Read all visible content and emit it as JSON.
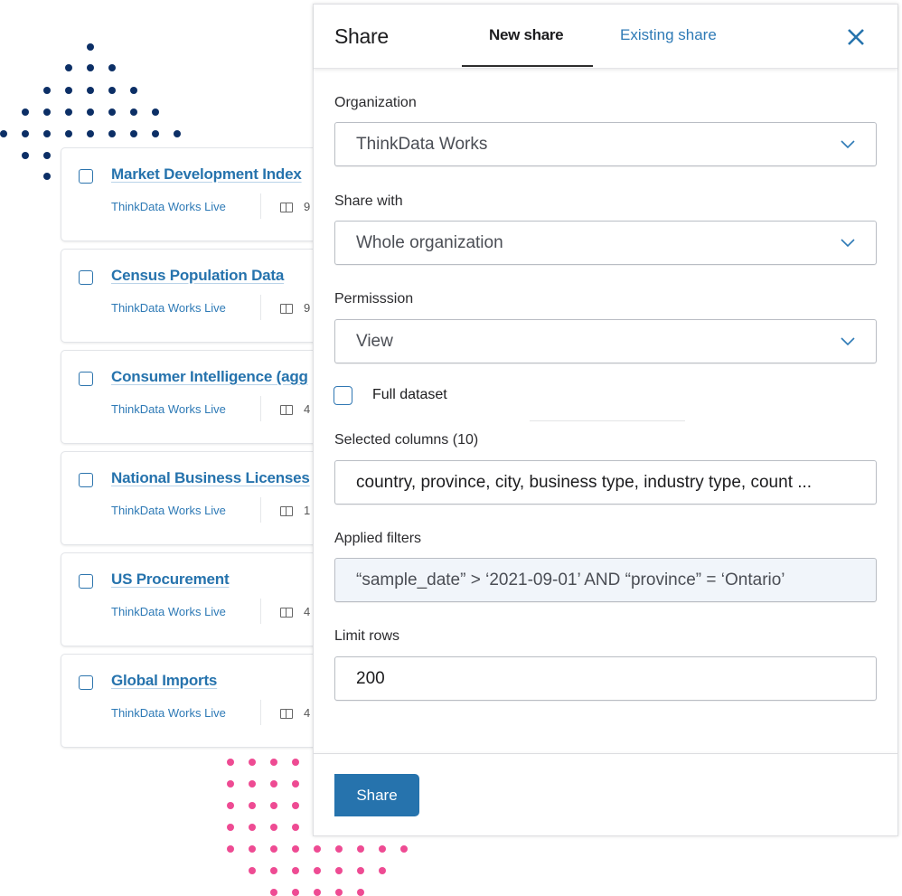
{
  "colors": {
    "accent": "#2673ad",
    "navy_dots": "#0c2f66",
    "pink_dots": "#ee4b93"
  },
  "datasets": [
    {
      "title": "Market Development Index",
      "provider": "ThinkData Works Live",
      "count_partial": "9",
      "icon": "columns-icon"
    },
    {
      "title": "Census Population Data",
      "provider": "ThinkData Works Live",
      "count_partial": "9",
      "icon": "columns-icon"
    },
    {
      "title": "Consumer Intelligence (agg",
      "provider": "ThinkData Works Live",
      "count_partial": "4",
      "icon": "columns-icon"
    },
    {
      "title": "National Business Licenses",
      "provider": "ThinkData Works Live",
      "count_partial": "1",
      "icon": "columns-icon"
    },
    {
      "title": "US Procurement",
      "provider": "ThinkData Works Live",
      "count_partial": "4",
      "icon": "columns-icon"
    },
    {
      "title": "Global Imports",
      "provider": "ThinkData Works Live",
      "count_partial": "4",
      "icon": "columns-icon"
    }
  ],
  "share_panel": {
    "title": "Share",
    "tabs": [
      {
        "label": "New share",
        "active": true
      },
      {
        "label": "Existing share",
        "active": false
      }
    ],
    "close_icon": "close-icon",
    "organization": {
      "label": "Organization",
      "value": "ThinkData Works"
    },
    "share_with": {
      "label": "Share with",
      "value": "Whole organization"
    },
    "permission": {
      "label": "Permisssion",
      "value": "View"
    },
    "full_dataset": {
      "label": "Full dataset",
      "checked": false
    },
    "selected_columns": {
      "label": "Selected columns (10)",
      "value": "country, province, city, business type, industry type, count ..."
    },
    "applied_filters": {
      "label": "Applied filters",
      "value": "“sample_date” > ‘2021-09-01’ AND “province” = ‘Ontario’"
    },
    "limit_rows": {
      "label": "Limit rows",
      "value": "200"
    },
    "submit_label": "Share"
  }
}
